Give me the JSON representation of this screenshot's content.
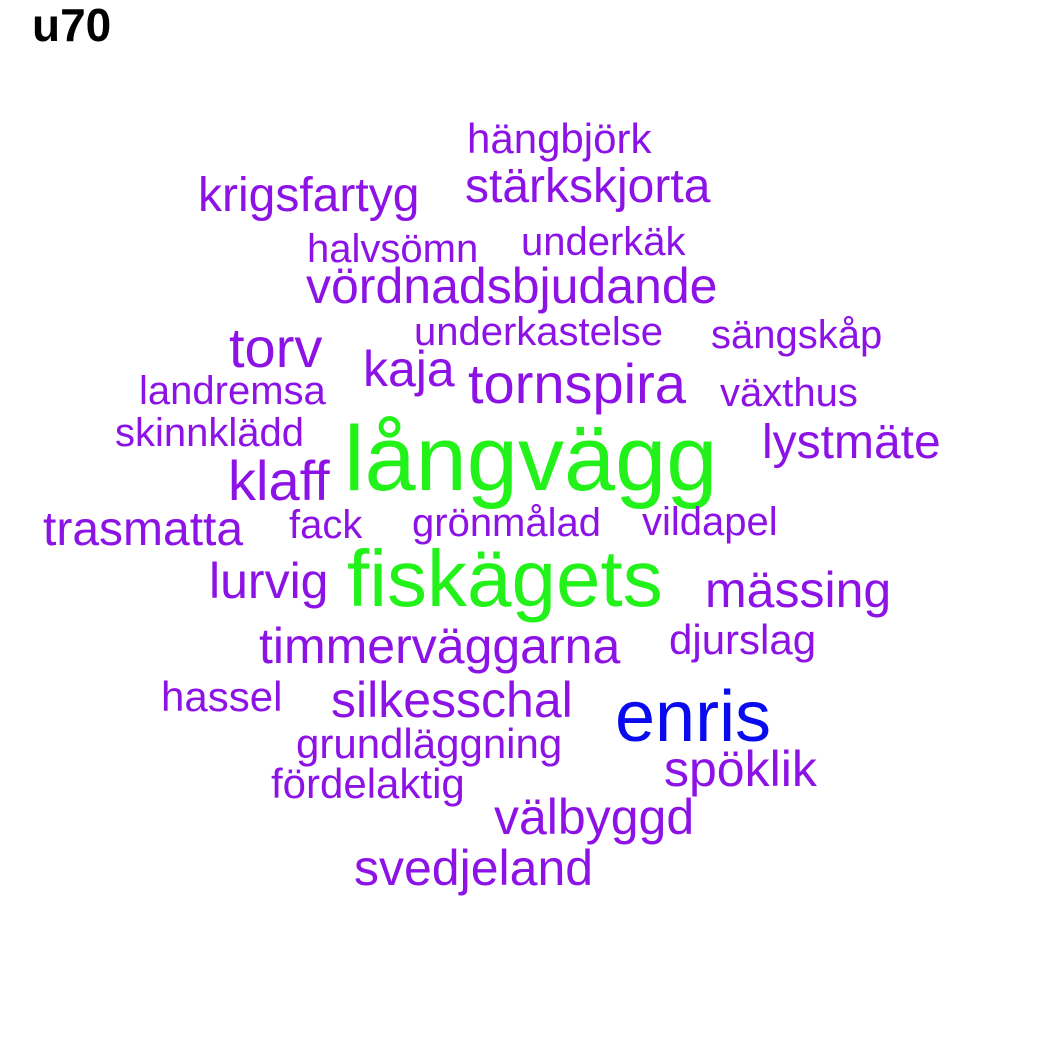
{
  "title": "u70",
  "colors": {
    "purple": "#8c12e6",
    "green": "#23f21a",
    "blue": "#0a0af0"
  },
  "words": [
    {
      "text": "hängbjörk",
      "color": "purple"
    },
    {
      "text": "krigsfartyg",
      "color": "purple"
    },
    {
      "text": "stärkskjorta",
      "color": "purple"
    },
    {
      "text": "halvsömn",
      "color": "purple"
    },
    {
      "text": "underkäk",
      "color": "purple"
    },
    {
      "text": "vördnadsbjudande",
      "color": "purple"
    },
    {
      "text": "torv",
      "color": "purple"
    },
    {
      "text": "underkastelse",
      "color": "purple"
    },
    {
      "text": "sängskåp",
      "color": "purple"
    },
    {
      "text": "kaja",
      "color": "purple"
    },
    {
      "text": "tornspira",
      "color": "purple"
    },
    {
      "text": "landremsa",
      "color": "purple"
    },
    {
      "text": "växthus",
      "color": "purple"
    },
    {
      "text": "skinnklädd",
      "color": "purple"
    },
    {
      "text": "långvägg",
      "color": "green"
    },
    {
      "text": "lystmäte",
      "color": "purple"
    },
    {
      "text": "klaff",
      "color": "purple"
    },
    {
      "text": "trasmatta",
      "color": "purple"
    },
    {
      "text": "fack",
      "color": "purple"
    },
    {
      "text": "grönmålad",
      "color": "purple"
    },
    {
      "text": "vildapel",
      "color": "purple"
    },
    {
      "text": "lurvig",
      "color": "purple"
    },
    {
      "text": "fiskägets",
      "color": "green"
    },
    {
      "text": "mässing",
      "color": "purple"
    },
    {
      "text": "timmerväggarna",
      "color": "purple"
    },
    {
      "text": "djurslag",
      "color": "purple"
    },
    {
      "text": "hassel",
      "color": "purple"
    },
    {
      "text": "silkesschal",
      "color": "purple"
    },
    {
      "text": "enris",
      "color": "blue"
    },
    {
      "text": "grundläggning",
      "color": "purple"
    },
    {
      "text": "spöklik",
      "color": "purple"
    },
    {
      "text": "fördelaktig",
      "color": "purple"
    },
    {
      "text": "välbyggd",
      "color": "purple"
    },
    {
      "text": "svedjeland",
      "color": "purple"
    }
  ]
}
